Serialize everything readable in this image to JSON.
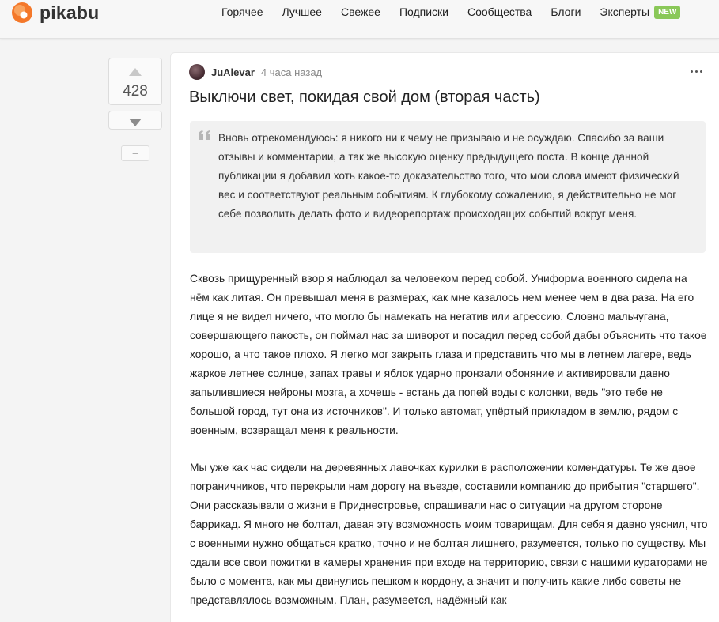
{
  "header": {
    "logo_text": "pikabu",
    "nav": [
      {
        "label": "Горячее"
      },
      {
        "label": "Лучшее"
      },
      {
        "label": "Свежее"
      },
      {
        "label": "Подписки"
      },
      {
        "label": "Сообщества"
      },
      {
        "label": "Блоги"
      },
      {
        "label": "Эксперты"
      }
    ],
    "new_badge": "NEW"
  },
  "vote": {
    "count": "428",
    "collapse_label": "–"
  },
  "post": {
    "author": "JuAlevar",
    "time": "4 часа назад",
    "title": "Выключи свет, покидая свой дом (вторая часть)",
    "quote": "Вновь отрекомендуюсь: я никого ни к чему не призываю и не осуждаю. Спасибо за ваши отзывы и комментарии, а так же высокую оценку предыдущего поста. В конце данной публикации я добавил хоть какое-то доказательство того, что мои слова имеют физический вес и соответствуют реальным событиям. К глубокому сожалению, я действительно не мог себе позволить делать фото и видеорепортаж происходящих событий вокруг меня.",
    "paragraphs": [
      "Сквозь прищуренный взор я наблюдал за человеком перед собой. Униформа военного сидела на нём как литая. Он превышал меня в размерах, как мне казалось нем менее чем в два раза. На его лице я не видел ничего, что могло бы намекать на негатив или агрессию. Словно мальчугана, совершающего пакость, он поймал нас за шиворот и посадил перед собой дабы объяснить что такое хорошо, а что такое плохо. Я легко мог закрыть глаза и представить что мы в летнем лагере, ведь жаркое летнее солнце, запах травы и яблок ударно пронзали обоняние и активировали давно запылившиеся нейроны мозга, а хочешь - встань да попей воды с колонки, ведь \"это тебе не большой город, тут она из источников\". И только автомат, упёртый прикладом в землю, рядом с военным, возвращал меня к реальности.",
      "Мы уже как час сидели на деревянных лавочках курилки в расположении комендатуры. Те же двое пограничников, что перекрыли нам дорогу на въезде, составили компанию до прибытия \"старшего\". Они рассказывали о жизни в Приднестровье, спрашивали нас о ситуации на другом стороне баррикад. Я много не болтал, давая эту возможность моим товарищам. Для себя я давно уяснил, что с военными нужно общаться кратко, точно и не болтая лишнего, разумеется, только по существу. Мы сдали все свои пожитки в камеры хранения при входе на территорию, связи с нашими кураторами не было с момента, как мы двинулись пешком к кордону, а значит и получить какие либо советы не представлялось возможным. План, разумеется, надёжный как"
    ]
  },
  "colors": {
    "logo_orange": "#f4782a",
    "badge_green": "#8ac858",
    "quote_bg": "#f1f1f1"
  }
}
